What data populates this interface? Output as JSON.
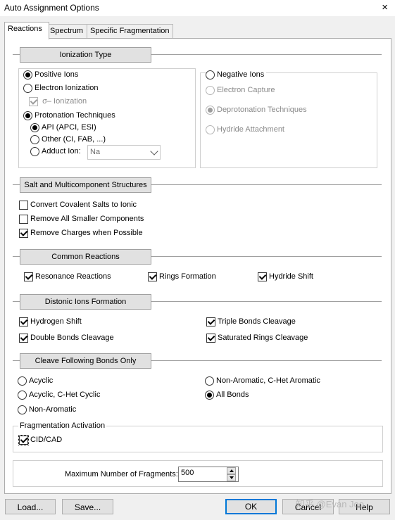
{
  "window": {
    "title": "Auto Assignment Options",
    "close_icon": "×"
  },
  "tabs": [
    "Reactions",
    "Spectrum",
    "Specific Fragmentation"
  ],
  "ionization": {
    "header": "Ionization Type",
    "positive": "Positive Ions",
    "electron": "Electron Ionization",
    "sigma": "σ– Ionization",
    "protonation": "Protonation Techniques",
    "api": "API (APCI, ESI)",
    "other": "Other (CI, FAB, ...)",
    "adduct": "Adduct Ion:",
    "adduct_value": "Na",
    "negative": "Negative Ions",
    "electron_capture": "Electron Capture",
    "deprotonation": "Deprotonation Techniques",
    "hydride_attach": "Hydride Attachment"
  },
  "salt": {
    "header": "Salt and Multicomponent Structures",
    "items": [
      "Convert Covalent Salts to Ionic",
      "Remove All Smaller Components",
      "Remove Charges when Possible"
    ]
  },
  "common": {
    "header": "Common Reactions",
    "items": [
      "Resonance Reactions",
      "Rings Formation",
      "Hydride Shift"
    ]
  },
  "distonic": {
    "header": "Distonic Ions Formation",
    "items": [
      "Hydrogen Shift",
      "Triple Bonds Cleavage",
      "Double Bonds Cleavage",
      "Saturated Rings Cleavage"
    ]
  },
  "cleave": {
    "header": "Cleave Following Bonds Only",
    "items": [
      "Acyclic",
      "Non-Aromatic, C-Het Aromatic",
      "Acyclic, C-Het Cyclic",
      "All Bonds",
      "Non-Aromatic"
    ]
  },
  "activation": {
    "label": "Fragmentation Activation",
    "cid": "CID/CAD"
  },
  "max_fragments": {
    "label": "Maximum Number of Fragments:",
    "value": "500"
  },
  "buttons": {
    "load": "Load...",
    "save": "Save...",
    "ok": "OK",
    "cancel": "Cancel",
    "help": "Help"
  },
  "watermark": "知乎 @Evan Joo"
}
